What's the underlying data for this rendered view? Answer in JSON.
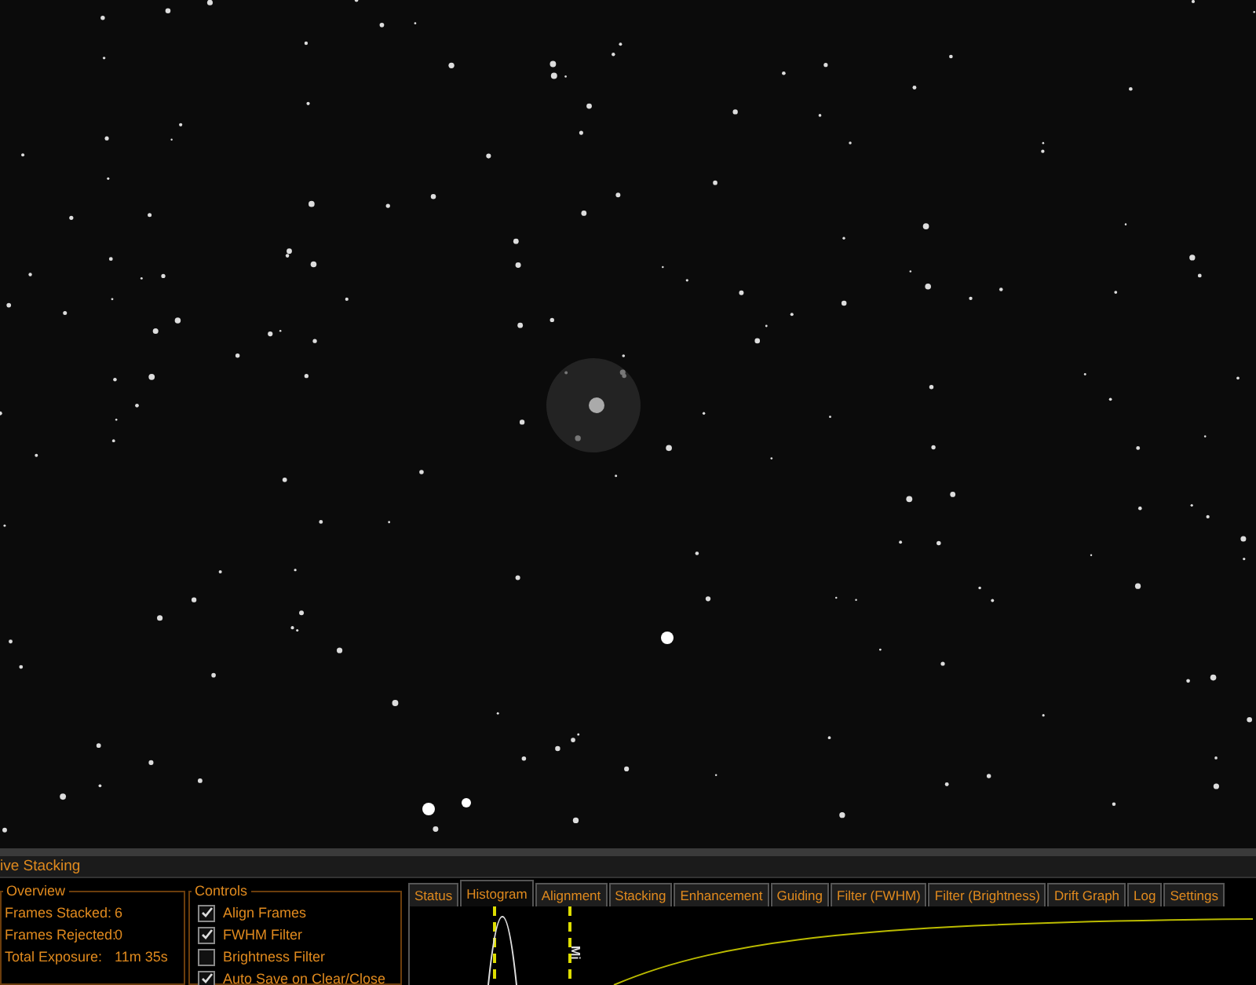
{
  "panel": {
    "title": "ive Stacking"
  },
  "overview": {
    "title": "Overview",
    "rows": [
      {
        "label": "Frames Stacked:",
        "value": "6"
      },
      {
        "label": "Frames Rejected:",
        "value": "0"
      },
      {
        "label": "Total Exposure:",
        "value": "11m 35s"
      }
    ]
  },
  "controls": {
    "title": "Controls",
    "items": [
      {
        "label": "Align Frames",
        "checked": true
      },
      {
        "label": "FWHM Filter",
        "checked": true
      },
      {
        "label": "Brightness Filter",
        "checked": false
      },
      {
        "label": "Auto Save on Clear/Close",
        "checked": true
      }
    ]
  },
  "tabs": [
    {
      "label": "Status",
      "selected": false
    },
    {
      "label": "Histogram",
      "selected": true
    },
    {
      "label": "Alignment",
      "selected": false
    },
    {
      "label": "Stacking",
      "selected": false
    },
    {
      "label": "Enhancement",
      "selected": false
    },
    {
      "label": "Guiding",
      "selected": false
    },
    {
      "label": "Filter (FWHM)",
      "selected": false
    },
    {
      "label": "Filter (Brightness)",
      "selected": false
    },
    {
      "label": "Drift Graph",
      "selected": false
    },
    {
      "label": "Log",
      "selected": false
    },
    {
      "label": "Settings",
      "selected": false
    }
  ],
  "histogram": {
    "marker_label": "Mi"
  }
}
